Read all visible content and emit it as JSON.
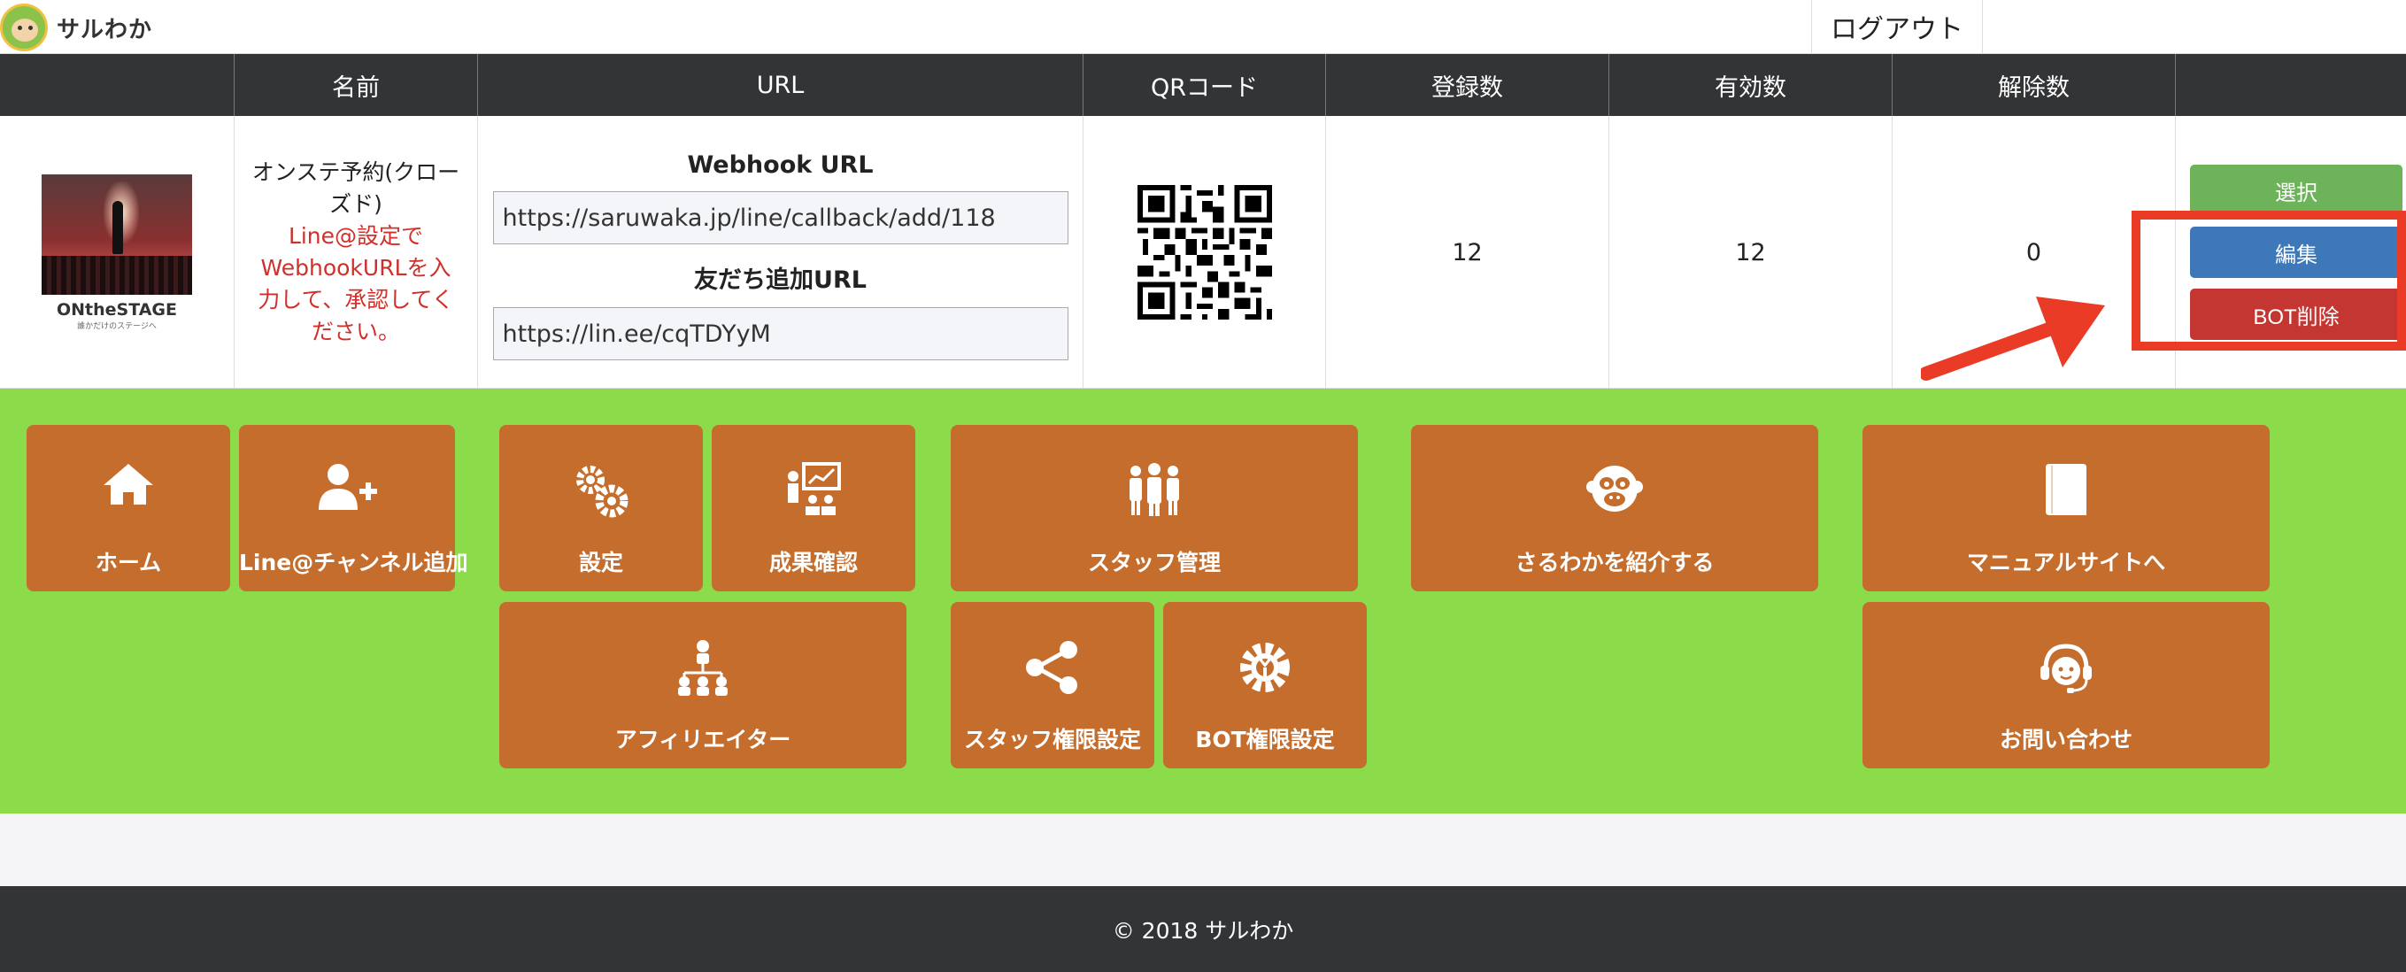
{
  "header": {
    "logo_text": "サルわか",
    "logout_label": "ログアウト"
  },
  "table": {
    "headers": [
      "名前",
      "URL",
      "QRコード",
      "登録数",
      "有効数",
      "解除数"
    ],
    "row": {
      "thumbnail_brand": "ONtheSTAGE",
      "thumbnail_subtitle": "誰かだけのステージへ",
      "name_line1": "オンステ予約(クロー",
      "name_line2": "ズド)",
      "warning_line1": "Line@設定で",
      "warning_line2": "WebhookURLを入",
      "warning_line3": "力して、承認してく",
      "warning_line4": "ださい。",
      "webhook_label": "Webhook URL",
      "webhook_url": "https://saruwaka.jp/line/callback/add/118",
      "friend_label": "友だち追加URL",
      "friend_url": "https://lin.ee/cqTDYyM",
      "registered": "12",
      "active": "12",
      "cancelled": "0",
      "btn_select": "選択",
      "btn_edit": "編集",
      "btn_delete": "BOT削除"
    }
  },
  "menu": {
    "home": "ホーム",
    "add_channel": "Line@チャンネル追加",
    "settings": "設定",
    "results": "成果確認",
    "staff": "スタッフ管理",
    "introduce": "さるわかを紹介する",
    "manual": "マニュアルサイトへ",
    "affiliate": "アフィリエイター",
    "staff_perm": "スタッフ権限設定",
    "bot_perm": "BOT権限設定",
    "contact": "お問い合わせ"
  },
  "footer": {
    "copyright": "© 2018 サルわか"
  },
  "colors": {
    "tile": "#c46d2c",
    "green_bg": "#8bdb4a",
    "header_bg": "#333436",
    "highlight": "#ea3b26"
  }
}
